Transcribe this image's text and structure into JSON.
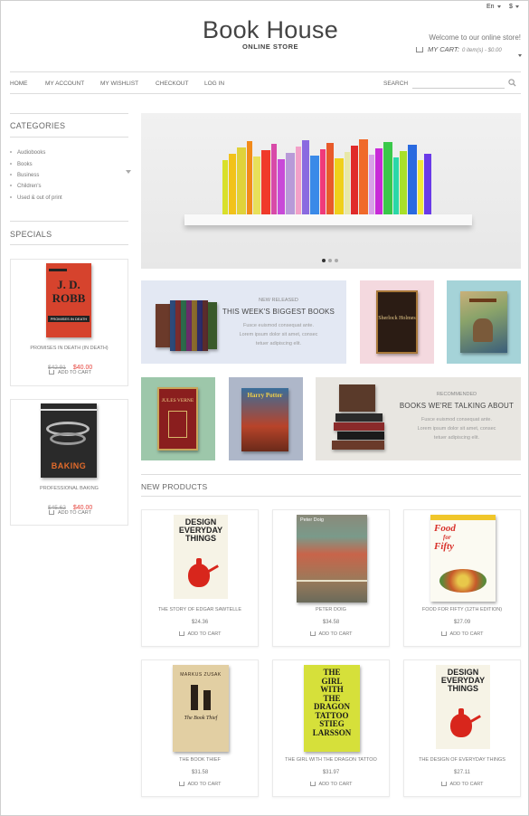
{
  "topbar": {
    "language": "En",
    "currency": "$"
  },
  "header": {
    "title": "Book House",
    "subtitle": "ONLINE STORE",
    "welcome": "Welcome to our online store!",
    "cart_label": "MY CART:",
    "cart_summary": "0 item(s) - $0.00"
  },
  "nav": {
    "items": [
      "HOME",
      "MY ACCOUNT",
      "MY WISHLIST",
      "CHECKOUT",
      "LOG IN"
    ],
    "search_label": "SEARCH",
    "search_value": ""
  },
  "sidebar": {
    "categories_title": "CATEGORIES",
    "categories": [
      "Audiobooks",
      "Books",
      "Business",
      "Children's",
      "Used & out of print"
    ],
    "specials_title": "SPECIALS",
    "specials": [
      {
        "name": "PROMISES IN DEATH (IN DEATH)",
        "old_price": "$42.91",
        "price": "$40.00",
        "cta": "ADD TO CART",
        "cover_lines": [
          "J. D.",
          "ROBB",
          "PROMISES IN DEATH"
        ]
      },
      {
        "name": "PROFESSIONAL BAKING",
        "old_price": "$45.62",
        "price": "$40.00",
        "cta": "ADD TO CART",
        "cover_lines": [
          "BAKING"
        ]
      }
    ]
  },
  "slider": {
    "dots": 3,
    "active": 0
  },
  "banners": {
    "new_released": {
      "kicker": "NEW RELEASED",
      "title": "THIS WEEK'S BIGGEST BOOKS",
      "text": [
        "Fusce euismod consequat ante.",
        "Lorem ipsum dolor sit amet, consec",
        "tetuer adipiscing elit."
      ]
    },
    "recommended": {
      "kicker": "RECOMMENDED",
      "title": "BOOKS WE'RE TALKING ABOUT",
      "text": [
        "Fusce euismod consequat ante.",
        "Lorem ipsum dolor sit amet, consec",
        "tetuer adipiscing elit."
      ]
    },
    "covers": {
      "sherlock": "Sherlock Holmes",
      "verne": "JULES VERNE",
      "potter": "Harry Potter"
    }
  },
  "new_products": {
    "title": "NEW PRODUCTS",
    "items": [
      {
        "name": "THE STORY OF EDGAR SAWTELLE",
        "price": "$24.36",
        "cta": "ADD TO CART",
        "cover": [
          "DESIGN",
          "EVERYDAY",
          "THINGS"
        ]
      },
      {
        "name": "PETER DOIG",
        "price": "$34.58",
        "cta": "ADD TO CART",
        "cover": [
          "Peter Doig"
        ]
      },
      {
        "name": "FOOD FOR FIFTY (12TH EDITION)",
        "price": "$27.09",
        "cta": "ADD TO CART",
        "cover": [
          "Food",
          "for",
          "Fifty"
        ]
      },
      {
        "name": "THE BOOK THIEF",
        "price": "$31.58",
        "cta": "ADD TO CART",
        "cover": [
          "MARKUS ZUSAK",
          "The Book Thief"
        ]
      },
      {
        "name": "THE GIRL WITH THE DRAGON TATTOO",
        "price": "$31.97",
        "cta": "ADD TO CART",
        "cover": [
          "THE",
          "GIRL",
          "WITH",
          "THE",
          "DRAGON",
          "TATTOO",
          "STIEG",
          "LARSSON"
        ]
      },
      {
        "name": "THE DESIGN OF EVERYDAY THINGS",
        "price": "$27.11",
        "cta": "ADD TO CART",
        "cover": [
          "DESIGN",
          "EVERYDAY",
          "THINGS"
        ]
      }
    ]
  },
  "colors": {
    "accent": "#e5423b",
    "text": "#555555",
    "border": "#dddddd"
  }
}
